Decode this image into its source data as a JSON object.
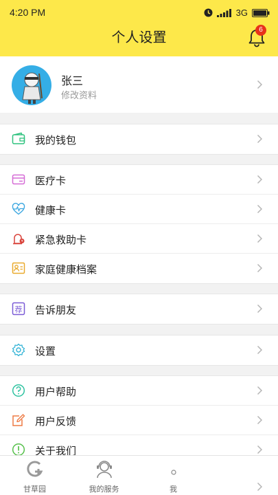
{
  "status_bar": {
    "time": "4:20 PM",
    "network": "3G"
  },
  "header": {
    "title": "个人设置",
    "notification_count": "6"
  },
  "profile": {
    "name": "张三",
    "subtitle": "修改资料"
  },
  "groups": [
    {
      "items": [
        {
          "label": "我的钱包",
          "icon": "wallet-icon",
          "color": "#2ec27e"
        }
      ]
    },
    {
      "items": [
        {
          "label": "医疗卡",
          "icon": "medical-card-icon",
          "color": "#d56bd6"
        },
        {
          "label": "健康卡",
          "icon": "heartbeat-icon",
          "color": "#3aa6e0"
        },
        {
          "label": "紧急救助卡",
          "icon": "emergency-icon",
          "color": "#d9433b"
        },
        {
          "label": "家庭健康档案",
          "icon": "family-record-icon",
          "color": "#e9a92b"
        }
      ]
    },
    {
      "items": [
        {
          "label": "告诉朋友",
          "icon": "recommend-icon",
          "color": "#7a5ad6"
        }
      ]
    },
    {
      "items": [
        {
          "label": "设置",
          "icon": "gear-icon",
          "color": "#33b3d6"
        }
      ]
    },
    {
      "items": [
        {
          "label": "用户帮助",
          "icon": "help-icon",
          "color": "#2ec2a0"
        },
        {
          "label": "用户反馈",
          "icon": "feedback-icon",
          "color": "#ee7a44"
        },
        {
          "label": "关于我们",
          "icon": "info-icon",
          "color": "#55c04a"
        }
      ]
    }
  ],
  "tabbar": {
    "tabs": [
      {
        "label": "甘草园",
        "icon": "gancao-logo-icon"
      },
      {
        "label": "我的服务",
        "icon": "service-person-icon"
      },
      {
        "label": "我",
        "icon": "me-icon"
      }
    ]
  },
  "colors": {
    "header_bg": "#fde84a",
    "badge": "#e8321a",
    "avatar_bg": "#35aee6"
  }
}
